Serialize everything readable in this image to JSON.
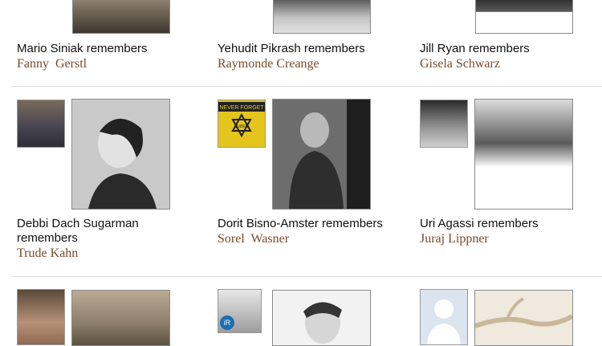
{
  "rows": [
    {
      "cards": [
        {
          "rememberer": "Mario Siniak remembers",
          "victim": "Fanny  Gerstl"
        },
        {
          "rememberer": "Yehudit Pikrash remembers",
          "victim": "Raymonde Creange"
        },
        {
          "rememberer": "Jill Ryan remembers",
          "victim": "Gisela Schwarz"
        }
      ]
    },
    {
      "cards": [
        {
          "rememberer": "Debbi Dach Sugarman remembers",
          "victim": "Trude Kahn"
        },
        {
          "rememberer": "Dorit Bisno-Amster remembers",
          "victim": "Sorel  Wasner"
        },
        {
          "rememberer": "Uri Agassi remembers",
          "victim": "Juraj Lippner"
        }
      ]
    }
  ],
  "badges": {
    "never_forget_line1": "NEVER FORGET",
    "never_forget_line2": "JUDEN",
    "ir_logo": "iR"
  }
}
